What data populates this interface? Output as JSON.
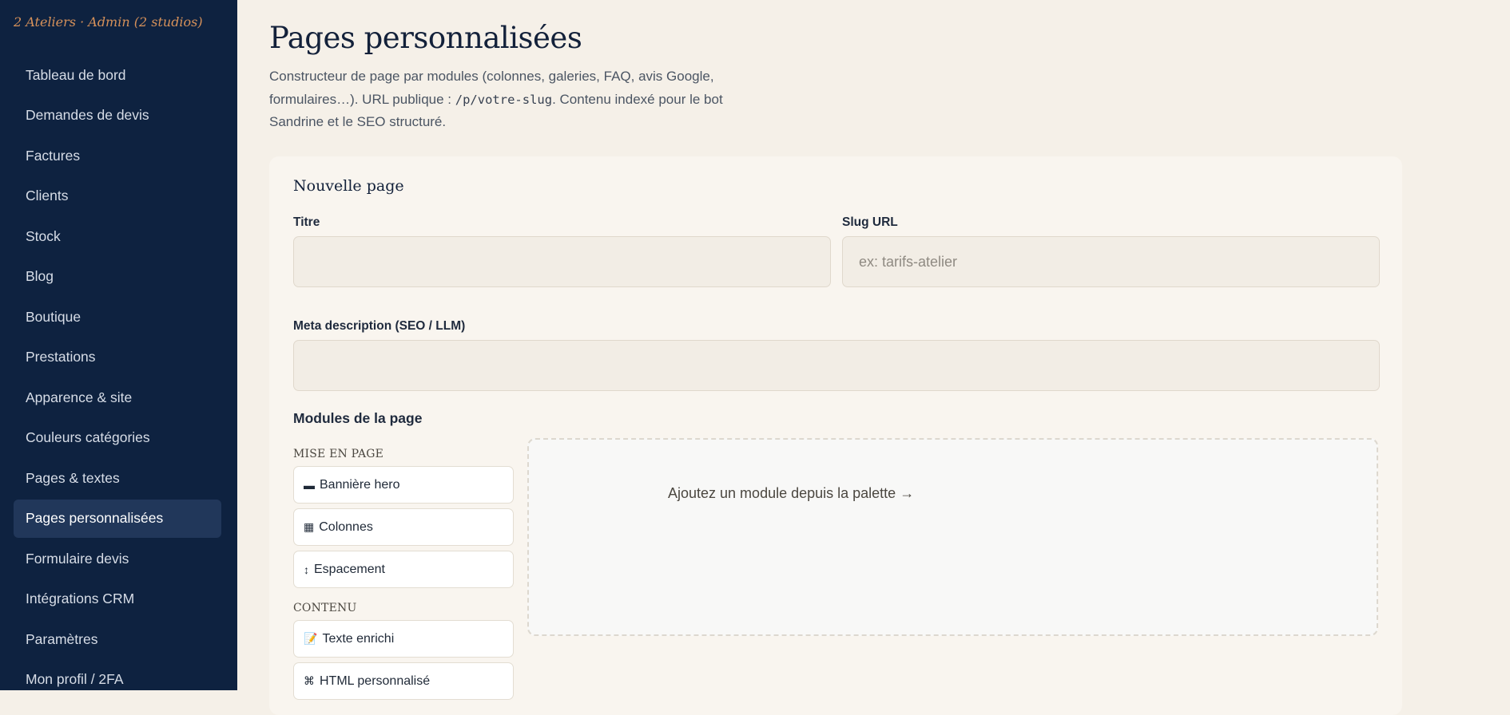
{
  "sidebar": {
    "brand": "2 Ateliers · Admin (2 studios)",
    "items": [
      {
        "label": "Tableau de bord"
      },
      {
        "label": "Demandes de devis"
      },
      {
        "label": "Factures"
      },
      {
        "label": "Clients"
      },
      {
        "label": "Stock"
      },
      {
        "label": "Blog"
      },
      {
        "label": "Boutique"
      },
      {
        "label": "Prestations"
      },
      {
        "label": "Apparence & site"
      },
      {
        "label": "Couleurs catégories"
      },
      {
        "label": "Pages & textes"
      },
      {
        "label": "Pages personnalisées",
        "active": true
      },
      {
        "label": "Formulaire devis"
      },
      {
        "label": "Intégrations CRM"
      },
      {
        "label": "Paramètres"
      },
      {
        "label": "Mon profil / 2FA"
      }
    ]
  },
  "page": {
    "title": "Pages personnalisées",
    "desc_part1": "Constructeur de page par modules (colonnes, galeries, FAQ, avis Google, formulaires…). URL publique : ",
    "desc_code": "/p/votre-slug",
    "desc_part2": ". Contenu indexé pour le bot Sandrine et le SEO structuré."
  },
  "form": {
    "card_title": "Nouvelle page",
    "title_label": "Titre",
    "title_value": "",
    "slug_label": "Slug URL",
    "slug_value": "",
    "slug_placeholder": "ex: tarifs-atelier",
    "meta_label": "Meta description (SEO / LLM)",
    "meta_value": ""
  },
  "modules": {
    "heading": "Modules de la page",
    "groups": [
      {
        "label": "MISE EN PAGE",
        "items": [
          {
            "icon": "hero-banner-icon",
            "glyph": "▬",
            "label": "Bannière hero"
          },
          {
            "icon": "columns-icon",
            "glyph": "▦",
            "label": "Colonnes"
          },
          {
            "icon": "spacing-icon",
            "glyph": "↕",
            "label": "Espacement"
          }
        ]
      },
      {
        "label": "CONTENU",
        "items": [
          {
            "icon": "rich-text-icon",
            "glyph": "📝",
            "label": "Texte enrichi"
          },
          {
            "icon": "html-icon",
            "glyph": "⌘",
            "label": "HTML personnalisé"
          }
        ]
      }
    ],
    "dropzone_hint": "Ajoutez un module depuis la palette →"
  }
}
